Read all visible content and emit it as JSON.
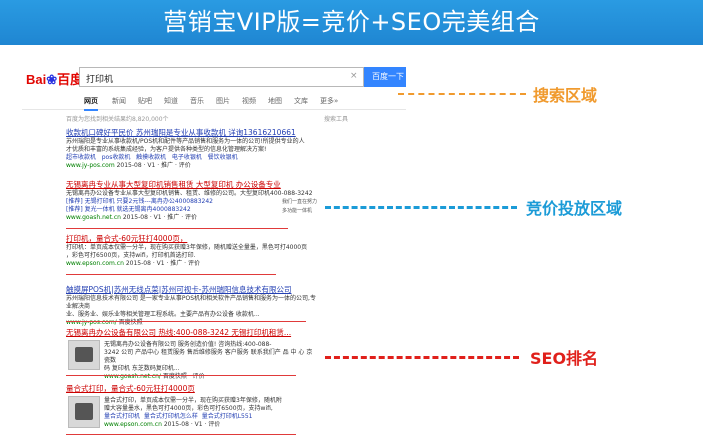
{
  "banner": {
    "title": "营销宝VIP版=竞价+SEO完美组合"
  },
  "baidu": {
    "logo_bai": "Bai",
    "logo_paw": "❀",
    "logo_du": "百度",
    "query": "打印机",
    "search_button": "百度一下",
    "tabs": [
      "网页",
      "新闻",
      "贴吧",
      "知道",
      "音乐",
      "图片",
      "视频",
      "地图",
      "文库",
      "更多»"
    ],
    "tools": "搜索工具",
    "stats": "百度为您找到相关结果约8,820,000个"
  },
  "results": [
    {
      "title": "收款机口碑好平民价 苏州瑞阳是专业从事收款机 详询13616210661",
      "desc1": "苏州瑞阳是专业从事收款机/POS机和配件等产品销售和服务为一体的公司!所提供专业的人",
      "desc2": "才优质和丰富的系统集成经验，为客户提供各种类型的信息化管理解决方案!",
      "links": [
        "超市收款机",
        "pos收款机",
        "触摸收款机",
        "电子收银机",
        "餐饮收银机"
      ],
      "url": "www.jy-pos.com",
      "meta": "2015-08 · V1 · 推广 · 评价"
    },
    {
      "title": "无锡离冉专业从事大型复印机销售租赁 大型复印机 办公设备专业",
      "desc1": "无锡离冉办公设备专业从事大型复印机销售、租赁、维修的公司。大型复印机400-088-3242",
      "rows": [
        {
          "tag": "[推荐]",
          "text": "无锡打印机 只要2元钱---离冉办公4000883242",
          "side": "我们一直在努力"
        },
        {
          "tag": "[推荐]",
          "text": "复光一体机 就选无锡离冉4000883242",
          "side": "多功能一体机"
        }
      ],
      "url": "www.goash.net.cn",
      "meta": "2015-08 · V1 · 推广 · 评价"
    },
    {
      "title": "打印机，量合式-60元狂打4000页，",
      "desc1": "打印机：单页成本仅需一分半，现在购买获赠3年保修，随机赠送全量墨，黑色可打4000页",
      "desc2": "，彩色可打6500页，支持wifi，打印机首选打印.",
      "url": "www.epson.com.cn",
      "meta": "2015-08 · V1 · 推广 · 评价"
    },
    {
      "title": "触摸屏POS机|苏州无线点菜|苏州可视卡-苏州瑞阳信息技术有限公司",
      "desc1": "苏州瑞阳信息技术有限公司 是一家专业从事POS机和相关软件产品销售和服务为一体的公司,专业解决商",
      "desc2": "业、服务业、娱乐业等相关管理工程系统。主要产品有办公设备 收款机...",
      "url": "www.jy-pos.com/",
      "meta": "百度快照"
    },
    {
      "title": "无锡离冉办公设备有限公司 热线:400-088-3242 无锡打印机租赁...",
      "desc1": "无锡离冉办公设备有限公司 服务创造价值! 咨询热线:400-088-",
      "desc2": "3242 公司 产品中心 租赁服务 售后维修服务 客户服务 联系我们产 品 中 心 京瓷数",
      "desc3": "码 复印机 东芝数码复印机...",
      "url": "www.goash.net.cn/",
      "meta": "百度快照 · 评价"
    },
    {
      "title": "量合式打印，量合式-60元狂打4000页",
      "desc1": "量合式打印，单页成本仅需一分半，现在购买获赠3年保修，随机附",
      "desc2": "赠大容量墨水，黑色可打4000页，彩色可打6500页，支持wifi,",
      "links": [
        "量合式打印机",
        "量合式打印机怎么样",
        "量合式打印机L551"
      ],
      "url": "www.epson.com.cn",
      "meta": "2015-08 · V1 · 评价"
    }
  ],
  "annotations": {
    "search": "搜索区域",
    "ppc": "竞价投放区域",
    "seo": "SEO排名"
  },
  "colors": {
    "banner": "#1f86d2",
    "search_label": "#f09a2e",
    "ppc_label": "#1b9bd7",
    "seo_label": "#e0201b"
  }
}
